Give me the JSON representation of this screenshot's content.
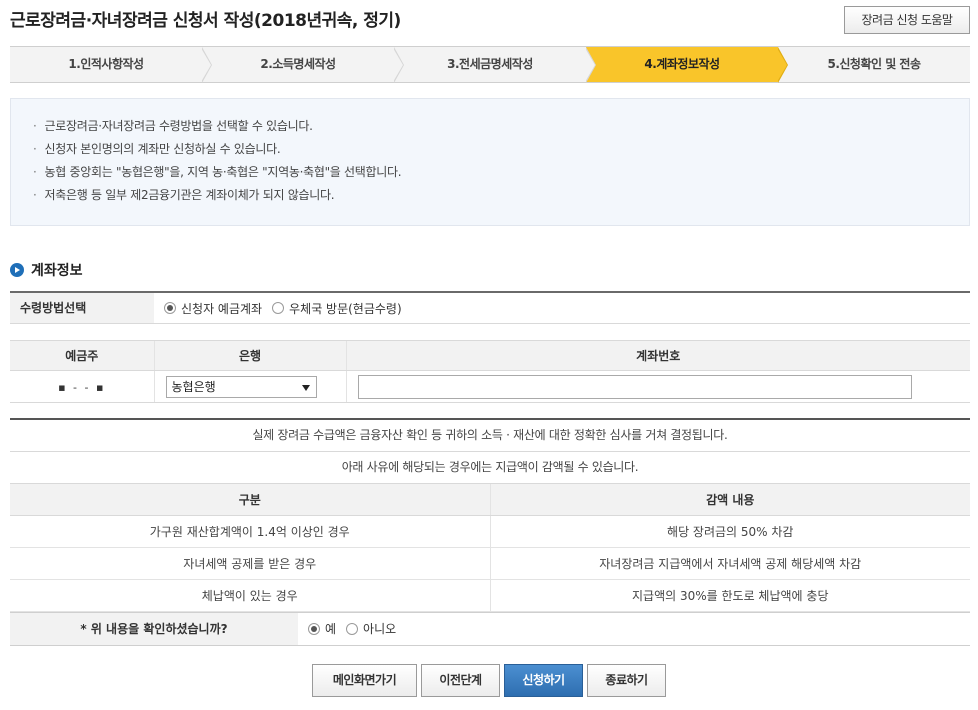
{
  "page": {
    "title": "근로장려금·자녀장려금 신청서 작성(2018년귀속, 정기)",
    "help_button": "장려금 신청 도움말"
  },
  "steps": [
    {
      "label": "1.인적사항작성",
      "active": false
    },
    {
      "label": "2.소득명세작성",
      "active": false
    },
    {
      "label": "3.전세금명세작성",
      "active": false
    },
    {
      "label": "4.계좌정보작성",
      "active": true
    },
    {
      "label": "5.신청확인 및 전송",
      "active": false
    }
  ],
  "info": {
    "items": [
      "근로장려금·자녀장려금 수령방법을 선택할 수 있습니다.",
      "신청자 본인명의의 계좌만 신청하실 수 있습니다.",
      "농협 중앙회는 \"농협은행\"을, 지역 농·축협은 \"지역농·축협\"을 선택합니다.",
      "저축은행 등 일부 제2금융기관은 계좌이체가 되지 않습니다."
    ]
  },
  "account_section": {
    "title": "계좌정보",
    "method_label": "수령방법선택",
    "method_options": [
      {
        "label": "신청자 예금계좌",
        "selected": true
      },
      {
        "label": "우체국 방문(현금수령)",
        "selected": false
      }
    ],
    "table": {
      "headers": [
        "예금주",
        "은행",
        "계좌번호"
      ],
      "owner_masked": "▪ - - ▪",
      "bank_selected": "농협은행",
      "account_number": ""
    }
  },
  "notice": {
    "line1": "실제 장려금 수급액은 금융자산 확인 등 귀하의 소득 · 재산에 대한 정확한 심사를 거쳐 결정됩니다.",
    "line2": "아래 사유에 해당되는 경우에는 지급액이 감액될 수 있습니다."
  },
  "reduction": {
    "headers": [
      "구분",
      "감액 내용"
    ],
    "rows": [
      [
        "가구원 재산합계액이 1.4억 이상인 경우",
        "해당 장려금의 50% 차감"
      ],
      [
        "자녀세액 공제를 받은 경우",
        "자녀장려금 지급액에서 자녀세액 공제 해당세액 차감"
      ],
      [
        "체납액이 있는 경우",
        "지급액의 30%를 한도로 체납액에 충당"
      ]
    ]
  },
  "confirm": {
    "question": "* 위 내용을 확인하셨습니까?",
    "options": [
      {
        "label": "예",
        "selected": true
      },
      {
        "label": "아니오",
        "selected": false
      }
    ]
  },
  "buttons": {
    "main": "메인화면가기",
    "prev": "이전단계",
    "apply": "신청하기",
    "exit": "종료하기"
  },
  "colors": {
    "active_step": "#f9c52a",
    "primary_button": "#2e6eb0",
    "info_background": "#f3f7fc"
  }
}
